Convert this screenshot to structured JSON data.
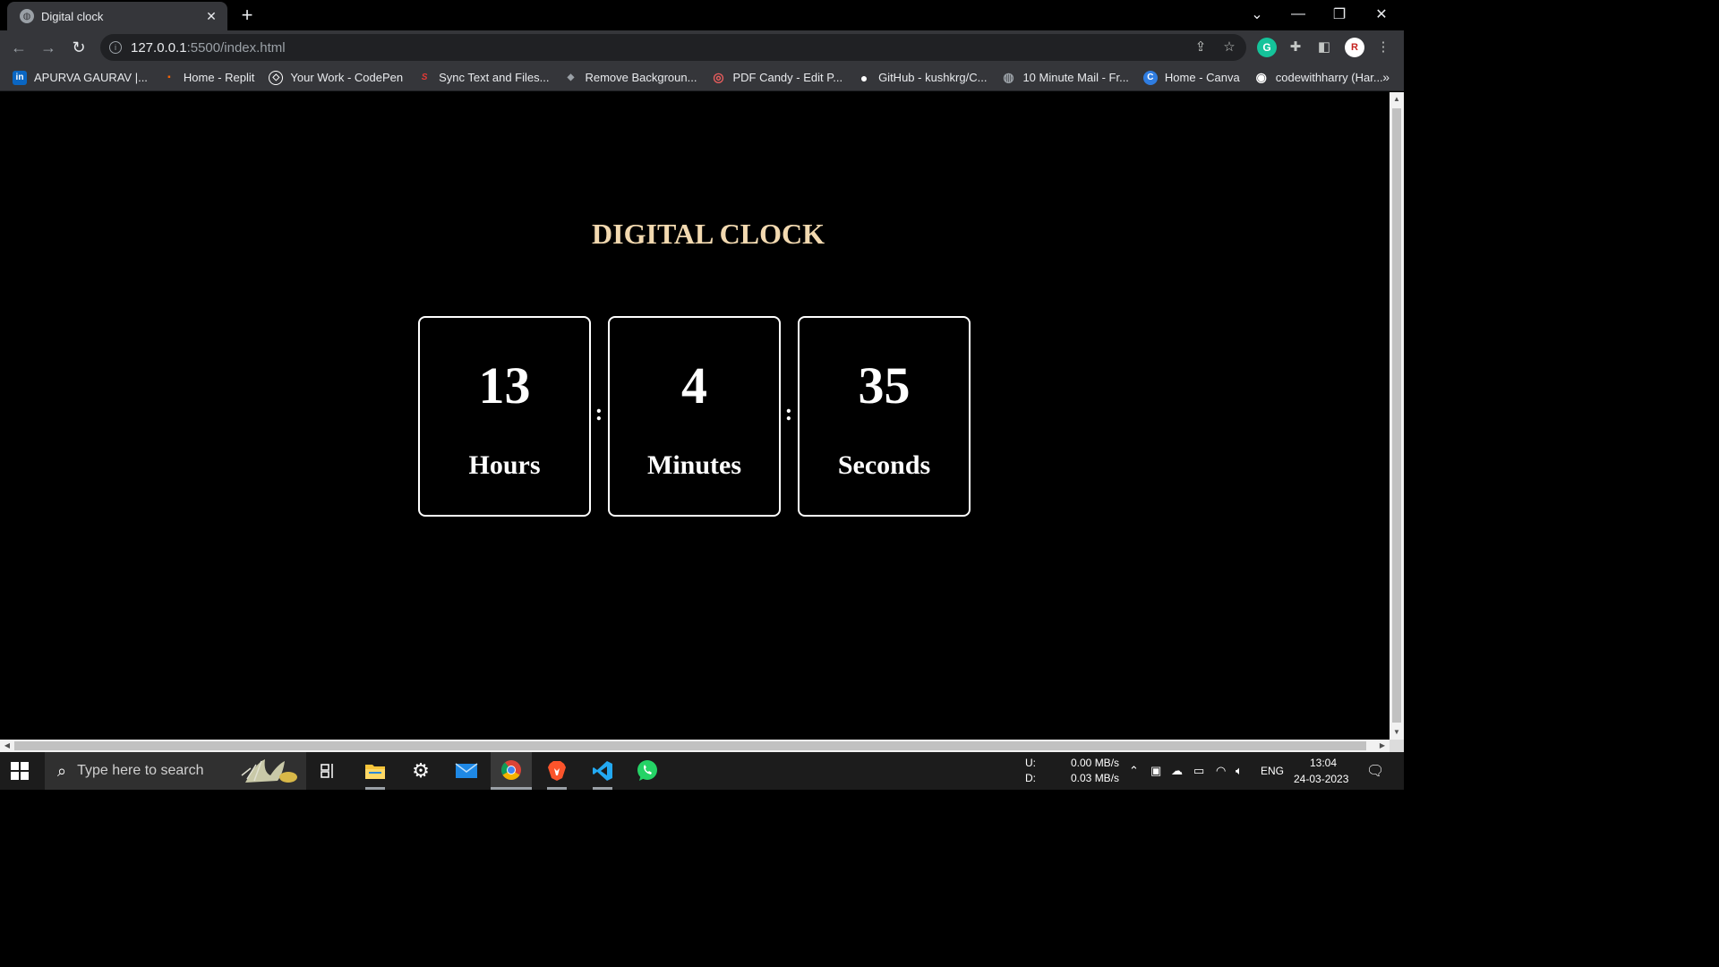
{
  "browser": {
    "tab_title": "Digital clock",
    "tab_close": "✕",
    "new_tab": "+",
    "url_host": "127.0.0.1",
    "url_path": ":5500/index.html",
    "back": "←",
    "forward": "→",
    "reload": "↻",
    "window_controls": {
      "tab_search": "⌄",
      "minimize": "—",
      "restore": "❐",
      "close": "✕"
    },
    "toolbar_icons": {
      "share": "⇪",
      "star": "☆",
      "grammarly": "G",
      "extensions": "✚",
      "side_panel": "◧",
      "profile": "R",
      "menu": "⋮"
    }
  },
  "bookmarks": [
    {
      "label": "APURVA GAURAV |...",
      "icon": "linkedin-icon",
      "glyph": "in",
      "color": "#0a66c2"
    },
    {
      "label": "Home - Replit",
      "icon": "replit-icon",
      "glyph": "▪",
      "color": "#f26207"
    },
    {
      "label": "Your Work - CodePen",
      "icon": "codepen-icon",
      "glyph": "◇",
      "color": "#35363a"
    },
    {
      "label": "Sync Text and Files...",
      "icon": "sync-icon",
      "glyph": "S",
      "color": "#c5221f"
    },
    {
      "label": "Remove Backgroun...",
      "icon": "removebg-icon",
      "glyph": "◆",
      "color": "#6c7a89"
    },
    {
      "label": "PDF Candy - Edit P...",
      "icon": "pdfcandy-icon",
      "glyph": "◎",
      "color": "#e85d5d"
    },
    {
      "label": "GitHub - kushkrg/C...",
      "icon": "github-icon",
      "glyph": "●",
      "color": "#35363a"
    },
    {
      "label": "10 Minute Mail - Fr...",
      "icon": "globe-icon",
      "glyph": "◍",
      "color": "#5f6368"
    },
    {
      "label": "Home - Canva",
      "icon": "canva-icon",
      "glyph": "C",
      "color": "#00c4cc"
    },
    {
      "label": "codewithharry (Har...",
      "icon": "codewithharry-icon",
      "glyph": "◉",
      "color": "#35363a"
    }
  ],
  "bookmarks_more": "»",
  "page": {
    "title": "DIGITAL CLOCK",
    "hours": "13",
    "minutes": "4",
    "seconds": "35",
    "hours_label": "Hours",
    "minutes_label": "Minutes",
    "seconds_label": "Seconds",
    "separator": ":"
  },
  "taskbar": {
    "search_placeholder": "Type here to search",
    "upload_label": "U:",
    "download_label": "D:",
    "upload_speed": "0.00 MB/s",
    "download_speed": "0.03 MB/s",
    "language": "ENG",
    "time": "13:04",
    "date": "24-03-2023"
  }
}
